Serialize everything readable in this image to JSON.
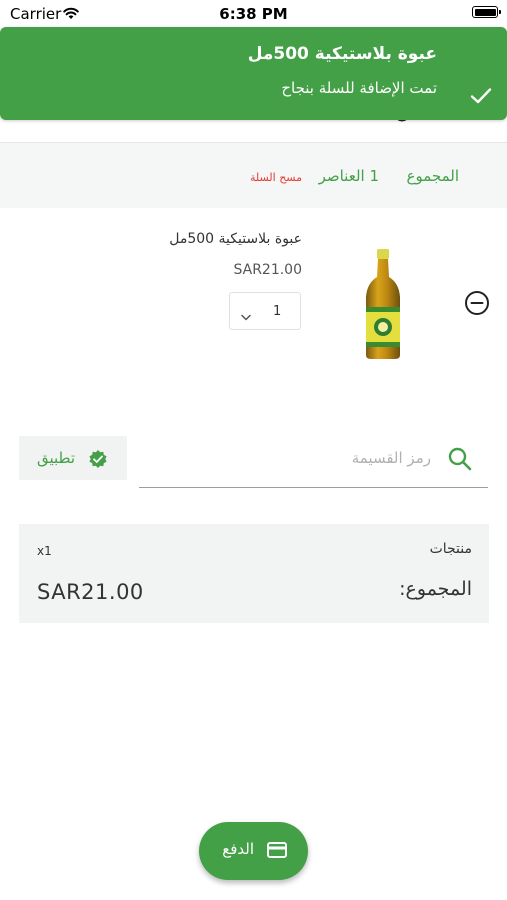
{
  "status_bar": {
    "carrier": "Carrier",
    "time": "6:38 PM"
  },
  "toast": {
    "title": "عبوة بلاستيكية 500مل",
    "message": "تمت الإضافة للسلة بنجاح",
    "color": "#43a047"
  },
  "cart_header": {
    "total_label": "المجموع",
    "items_count": "1 العناصر",
    "clear_cart": "مسح السلة"
  },
  "cart_items": [
    {
      "name": "عبوة بلاستيكية 500مل",
      "price": "SAR21.00",
      "quantity": "1"
    }
  ],
  "coupon": {
    "placeholder": "رمز القسيمة",
    "apply_label": "تطبيق"
  },
  "summary": {
    "products_label": "منتجات",
    "products_qty": "x1",
    "total_label": "المجموع:",
    "total_value": "SAR21.00"
  },
  "checkout": {
    "label": "الدفع"
  },
  "colors": {
    "accent": "#43a047",
    "danger": "#e53935",
    "panel": "#f2f4f4"
  },
  "icons": [
    "wifi-icon",
    "battery-icon",
    "check-icon",
    "remove-circle-icon",
    "chevron-down-icon",
    "verified-badge-icon",
    "search-icon",
    "credit-card-icon"
  ]
}
